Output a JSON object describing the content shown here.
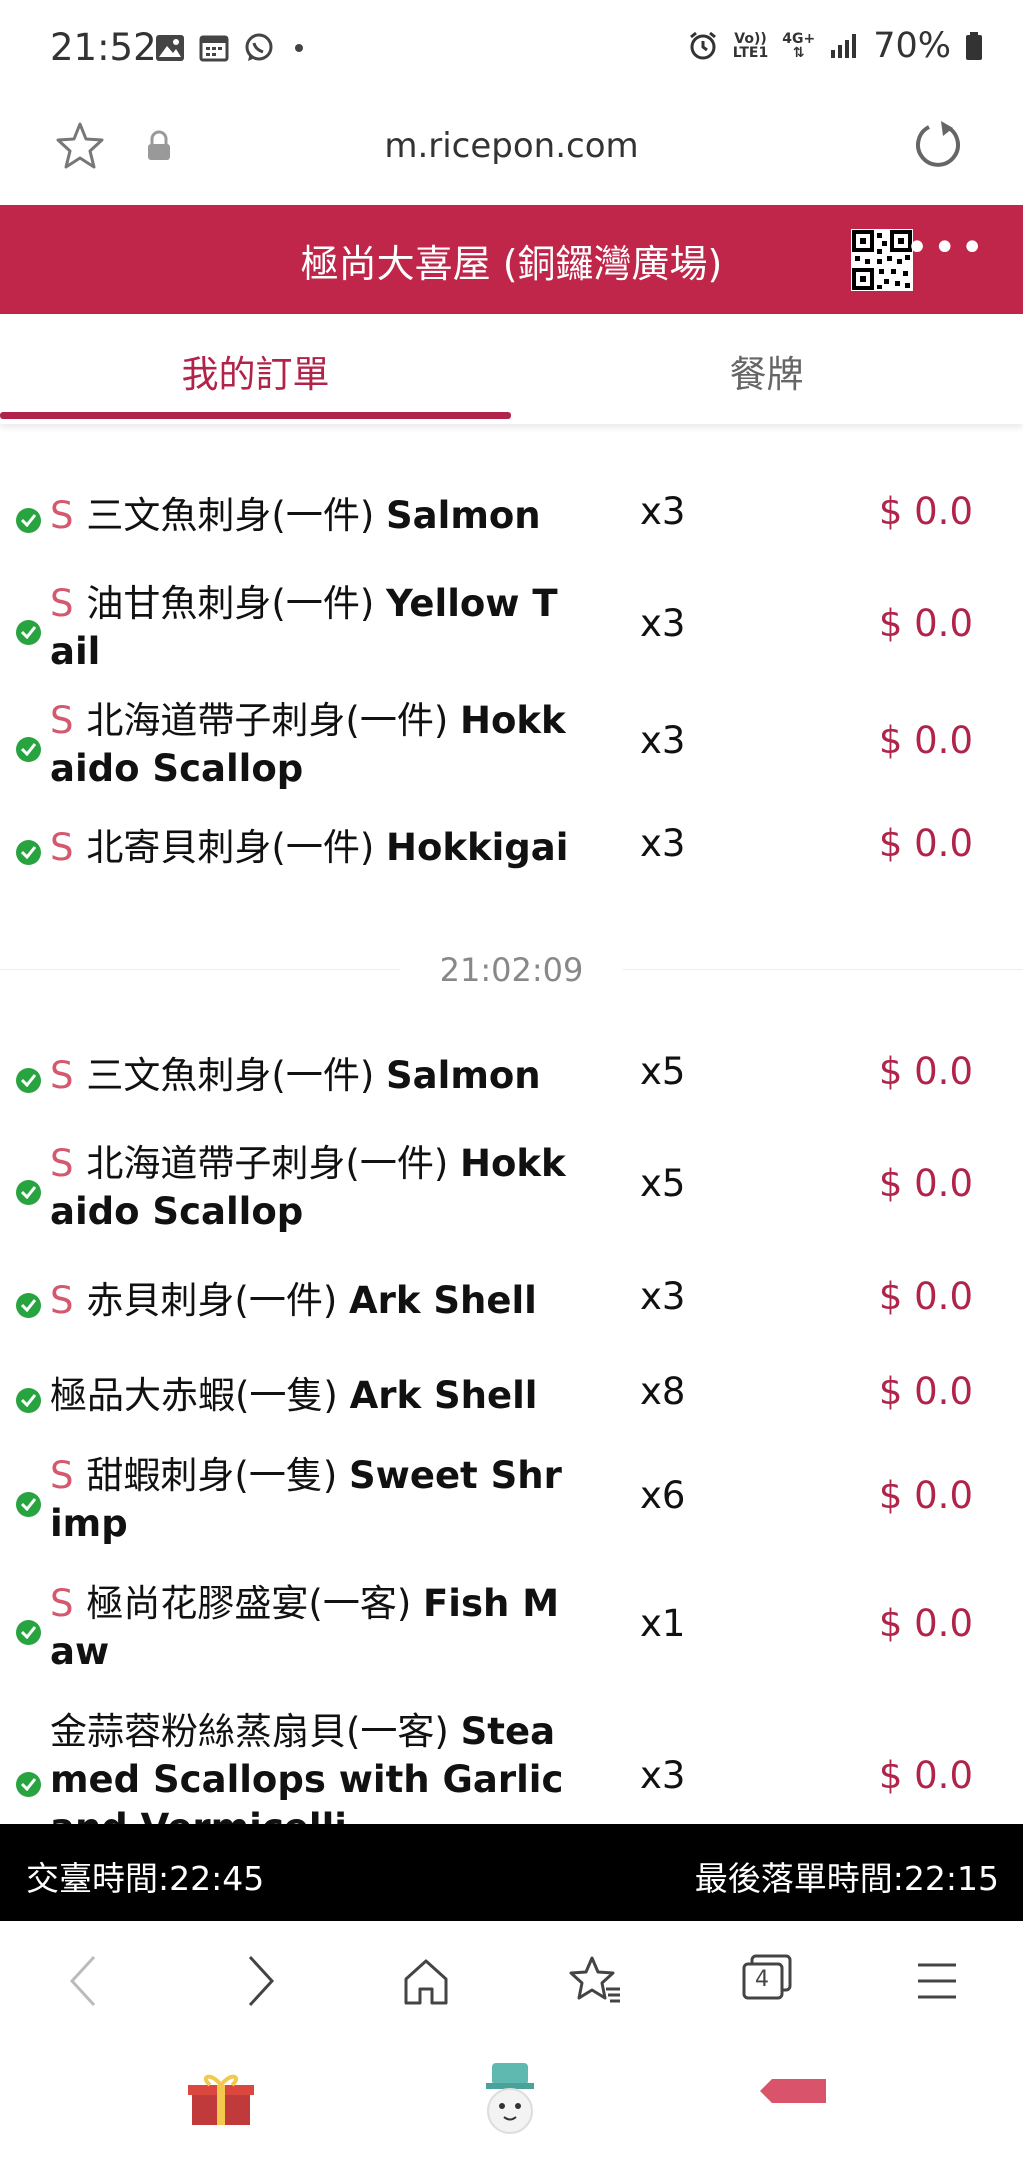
{
  "status_bar": {
    "time": "21:52",
    "battery": "70%",
    "signal_top": "Vo))",
    "signal_bottom": "LTE1",
    "net_type": "4G+"
  },
  "url_bar": {
    "url": "m.ricepon.com"
  },
  "header": {
    "title": "極尚大喜屋 (銅鑼灣廣場)"
  },
  "tabs": {
    "active": "我的訂單",
    "inactive": "餐牌"
  },
  "orders_group1": [
    {
      "s": "S",
      "cn": "三文魚刺身(一件) ",
      "en": "Salmon",
      "qty": "x3",
      "price": "$ 0.0"
    },
    {
      "s": "S",
      "cn": "油甘魚刺身(一件) ",
      "en": "Yellow Tail",
      "qty": "x3",
      "price": "$ 0.0"
    },
    {
      "s": "S",
      "cn": "北海道帶子刺身(一件) ",
      "en": "Hokkaido Scallop",
      "qty": "x3",
      "price": "$ 0.0"
    },
    {
      "s": "S",
      "cn": "北寄貝刺身(一件) ",
      "en": "Hokkigai",
      "qty": "x3",
      "price": "$ 0.0"
    }
  ],
  "separator": {
    "time": "21:02:09"
  },
  "orders_group2": [
    {
      "s": "S",
      "cn": "三文魚刺身(一件) ",
      "en": "Salmon",
      "qty": "x5",
      "price": "$ 0.0"
    },
    {
      "s": "S",
      "cn": "北海道帶子刺身(一件) ",
      "en": "Hokkaido Scallop",
      "qty": "x5",
      "price": "$ 0.0"
    },
    {
      "s": "S",
      "cn": "赤貝刺身(一件) ",
      "en": "Ark Shell",
      "qty": "x3",
      "price": "$ 0.0"
    },
    {
      "s": "",
      "cn": "極品大赤蝦(一隻) ",
      "en": "Ark Shell",
      "qty": "x8",
      "price": "$ 0.0"
    },
    {
      "s": "S",
      "cn": "甜蝦刺身(一隻) ",
      "en": "Sweet Shrimp",
      "qty": "x6",
      "price": "$ 0.0"
    },
    {
      "s": "S",
      "cn": "極尚花膠盛宴(一客) ",
      "en": "Fish Maw",
      "qty": "x1",
      "price": "$ 0.0"
    },
    {
      "s": "",
      "cn": "金蒜蓉粉絲蒸扇貝(一客) ",
      "en": "Steamed Scallops with Garlic and Vermicelli",
      "qty": "x3",
      "price": "$ 0.0"
    }
  ],
  "footer_bar": {
    "left": "交臺時間:22:45",
    "right": "最後落單時間:22:15"
  },
  "browser_nav": {
    "tab_count": "4"
  },
  "colors": {
    "brand": "#c0254a",
    "accent_text": "#b0244a",
    "check": "#27a33f"
  }
}
